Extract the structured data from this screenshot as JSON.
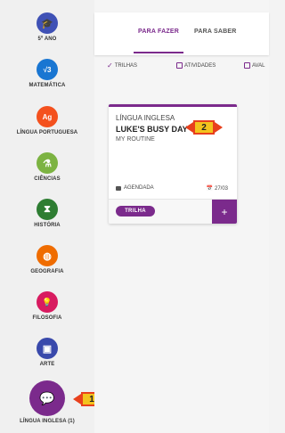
{
  "sidebar": {
    "items": [
      {
        "label": "5º ANO",
        "icon": "graduation-cap-icon",
        "glyph": "🎓",
        "color": "#3f51b5"
      },
      {
        "label": "MATEMÁTICA",
        "icon": "math-icon",
        "glyph": "√3",
        "color": "#1976d2"
      },
      {
        "label": "LÍNGUA PORTUGUESA",
        "icon": "language-icon",
        "glyph": "Ag",
        "color": "#f4511e"
      },
      {
        "label": "CIÊNCIAS",
        "icon": "flask-icon",
        "glyph": "⚗",
        "color": "#7cb342"
      },
      {
        "label": "HISTÓRIA",
        "icon": "hourglass-icon",
        "glyph": "⧗",
        "color": "#2e7d32"
      },
      {
        "label": "GEOGRAFIA",
        "icon": "globe-icon",
        "glyph": "◍",
        "color": "#ef6c00"
      },
      {
        "label": "FILOSOFIA",
        "icon": "lightbulb-icon",
        "glyph": "💡",
        "color": "#d81b60"
      },
      {
        "label": "ARTE",
        "icon": "image-icon",
        "glyph": "▣",
        "color": "#3949ab"
      },
      {
        "label": "LÍNGUA INGLESA (1)",
        "icon": "chat-icon",
        "glyph": "💬",
        "color": "#7b2a8c"
      }
    ]
  },
  "tabs": {
    "active": "PARA FAZER",
    "other": "PARA SABER"
  },
  "filters": {
    "trilhas": "TRILHAS",
    "atividades": "ATIVIDADES",
    "avaliacoes": "AVAL"
  },
  "card": {
    "subject": "LÍNGUA INGLESA",
    "title": "LUKE'S BUSY DAY",
    "subtitle": "MY ROUTINE",
    "status": "AGENDADA",
    "date": "📅 27/03",
    "pill": "TRILHA",
    "plus": "+"
  },
  "markers": {
    "one": "1",
    "two": "2"
  },
  "colors": {
    "accent": "#7b2a8c",
    "marker_border": "#e8401c",
    "marker_fill": "#f3c31d"
  }
}
